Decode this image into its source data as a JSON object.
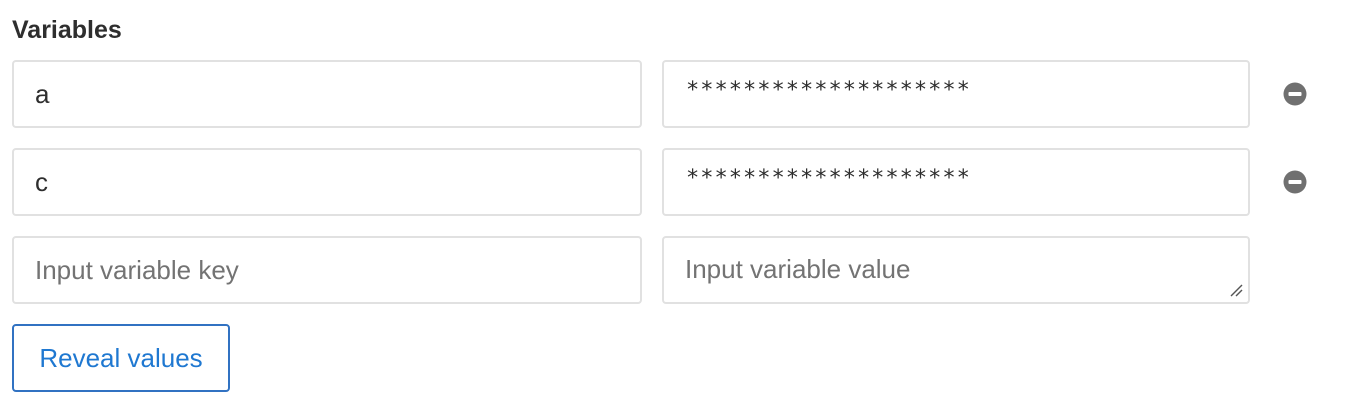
{
  "section": {
    "title": "Variables"
  },
  "variables": [
    {
      "key": "a",
      "value": "********************"
    },
    {
      "key": "c",
      "value": "********************"
    }
  ],
  "new_variable": {
    "key_placeholder": "Input variable key",
    "value_placeholder": "Input variable value"
  },
  "icons": {
    "remove": "minus-circle-icon",
    "resize": "resize-handle-icon"
  },
  "actions": {
    "reveal_label": "Reveal values"
  },
  "colors": {
    "accent": "#1f78d1",
    "border": "#e1e1e1",
    "remove_icon": "#707070"
  }
}
